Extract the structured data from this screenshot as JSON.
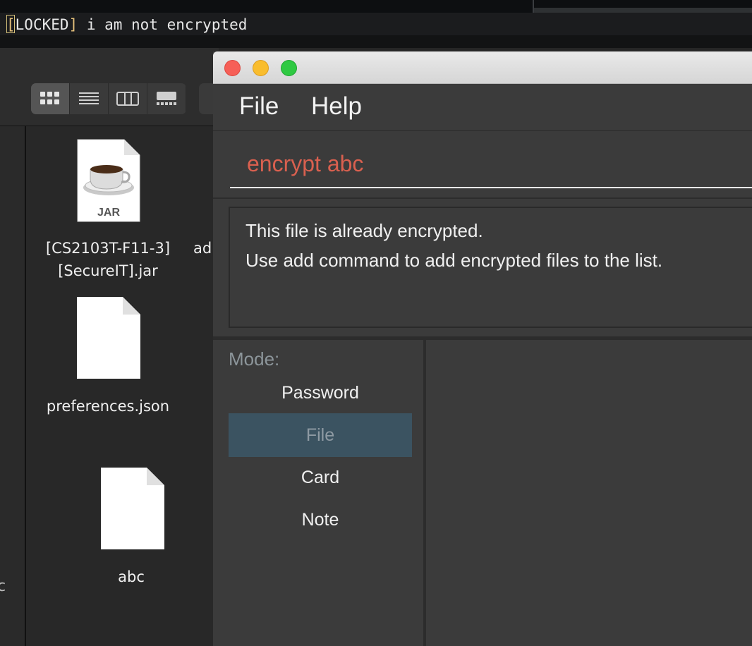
{
  "terminal": {
    "bracket_open": "[",
    "tag": "LOCKED",
    "bracket_close": "]",
    "message": " i am not encrypted"
  },
  "finder": {
    "view_buttons": [
      "icon-view-icon",
      "list-view-icon",
      "column-view-icon",
      "gallery-view-icon"
    ],
    "files": [
      {
        "name_line1": "[CS2103T-F11-3]",
        "name_line2": "[SecureIT].jar",
        "icon": "jar-file-icon",
        "icon_text": "JAR"
      },
      {
        "name_line1": "preferences.json",
        "icon": "document-icon"
      },
      {
        "name_line1": "abc",
        "icon": "document-icon"
      }
    ],
    "partial_label": "ad",
    "sidebar_partial": "c"
  },
  "app": {
    "menu": {
      "file": "File",
      "help": "Help"
    },
    "command_input": "encrypt abc",
    "result": {
      "line1": "This file is already encrypted.",
      "line2": "Use add command to add encrypted files to the list."
    },
    "mode": {
      "title": "Mode:",
      "items": [
        "Password",
        "File",
        "Card",
        "Note"
      ],
      "selected": "File"
    }
  },
  "colors": {
    "command_text": "#d9604f",
    "selected_mode_bg": "#3b5361",
    "window_bg": "#3b3b3b"
  }
}
